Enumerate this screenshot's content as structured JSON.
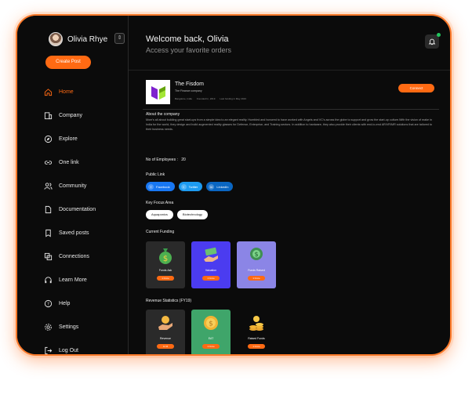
{
  "profile": {
    "name": "Olivia Rhye",
    "toggle_icon": "chevron-icon"
  },
  "sidebar": {
    "create_post": "Create Post",
    "items": [
      {
        "label": "Home",
        "icon": "home-icon",
        "active": true
      },
      {
        "label": "Company",
        "icon": "building-icon",
        "active": false
      },
      {
        "label": "Explore",
        "icon": "compass-icon",
        "active": false
      },
      {
        "label": "One link",
        "icon": "link-icon",
        "active": false
      },
      {
        "label": "Community",
        "icon": "users-icon",
        "active": false
      },
      {
        "label": "Documentation",
        "icon": "document-icon",
        "active": false
      },
      {
        "label": "Saved posts",
        "icon": "bookmark-icon",
        "active": false
      },
      {
        "label": "Connections",
        "icon": "connections-icon",
        "active": false
      },
      {
        "label": "Learn More",
        "icon": "headphones-icon",
        "active": false
      },
      {
        "label": "Help",
        "icon": "help-icon",
        "active": false
      },
      {
        "label": "Settings",
        "icon": "gear-icon",
        "active": false
      },
      {
        "label": "Log Out",
        "icon": "logout-icon",
        "active": false
      }
    ]
  },
  "header": {
    "welcome": "Welcome back, Olivia",
    "subtitle": "Access your favorite orders"
  },
  "company": {
    "name": "The Fisdom",
    "tagline": "The Finance company",
    "meta": [
      "Bangalore, India",
      "Founded In, 2019",
      "Last funding in May 2023"
    ],
    "connect": "Connect"
  },
  "about": {
    "title": "About the company",
    "text": "Mom's all about building great start-ups from a simple idea to an elegant reality. Humbled and honored to have worked with Angels and VC's across the globe to support and grow the start-up culture.With the vision of make in India for the world, they design and build augmented reality glasses for Defense, Enterprise, and Training sectors. In addition to hardware, they also provide their clients with end-to-end AR/VR/MR solutions that are tailored to their business needs."
  },
  "employees": {
    "label": "No of Employees :",
    "value": "20"
  },
  "public_links": {
    "title": "Public Link",
    "items": [
      {
        "label": "Facebook",
        "color": "#1877f2"
      },
      {
        "label": "Twitter",
        "color": "#1d9bf0"
      },
      {
        "label": "LinkedIn",
        "color": "#0a66c2"
      }
    ]
  },
  "focus": {
    "title": "Key Focus Area",
    "tags": [
      "Aquaponics",
      "Biotechnology"
    ]
  },
  "funding": {
    "title": "Current Funding",
    "cards": [
      {
        "label": "Funds Ask",
        "button": "1 Crore",
        "bg": "#2a2a2a",
        "icon": "money-bag-icon"
      },
      {
        "label": "Valuation",
        "button": "1 Crore",
        "bg": "#4b3cf0",
        "icon": "cash-hand-icon"
      },
      {
        "label": "Funds Raised",
        "button": "1 Crore",
        "bg": "#8b85e6",
        "icon": "money-stack-icon"
      }
    ]
  },
  "revenue": {
    "title": "Revenue Statistics (FY19)",
    "cards": [
      {
        "label": "Revenue",
        "button": "12 M",
        "bg": "#2a2a2a",
        "icon": "hand-coin-icon"
      },
      {
        "label": "EAT",
        "button": "1 Crore",
        "bg": "#3fa56a",
        "icon": "gold-coin-icon"
      },
      {
        "label": "Raised Funds",
        "button": "1 Crore",
        "bg": "#0b0b0b",
        "icon": "coin-stack-icon"
      }
    ]
  }
}
